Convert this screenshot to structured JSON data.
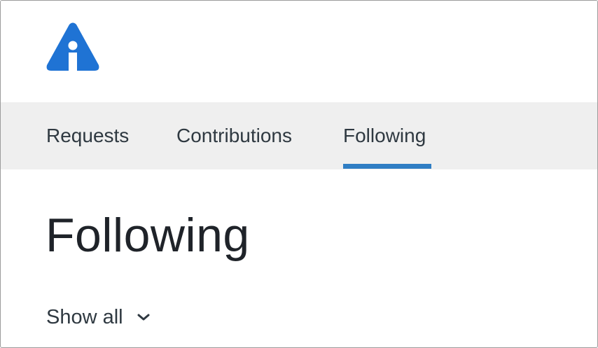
{
  "header": {
    "logo_icon": "help-center-logo-icon",
    "brand_color": "#1f73d4"
  },
  "nav": {
    "tabs": [
      {
        "label": "Requests",
        "active": false
      },
      {
        "label": "Contributions",
        "active": false
      },
      {
        "label": "Following",
        "active": true
      }
    ],
    "active_color": "#2f7ec4"
  },
  "main": {
    "title": "Following",
    "filter": {
      "label": "Show all",
      "icon": "chevron-down-icon"
    }
  }
}
